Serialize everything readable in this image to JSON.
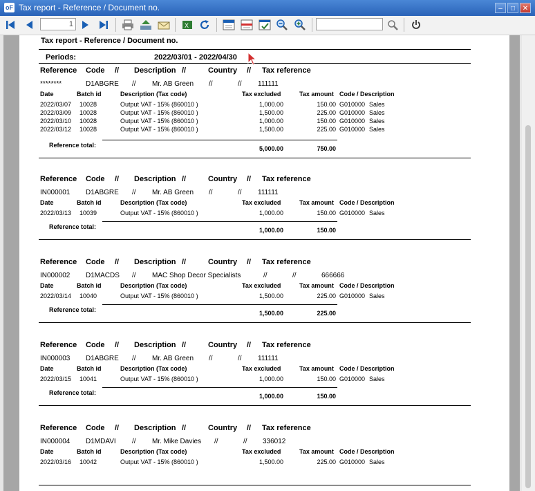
{
  "window": {
    "title": "Tax report - Reference / Document no.",
    "app_icon": "oF"
  },
  "toolbar": {
    "page_number": "1",
    "search_value": ""
  },
  "report": {
    "title": "Tax report - Reference / Document no.",
    "periods_label": "Periods:",
    "periods_value": "2022/03/01  -  2022/04/30",
    "group_header": {
      "reference": "Reference",
      "code": "Code",
      "sep1": "//",
      "description": "Description",
      "sep2": "//",
      "country": "Country",
      "sep3": "//",
      "tax_reference": "Tax reference"
    },
    "detail_header": {
      "date": "Date",
      "batch_id": "Batch id",
      "description": "Description (Tax code)",
      "tax_excluded": "Tax excluded",
      "tax_amount": "Tax amount",
      "code_desc": "Code / Description"
    },
    "reference_total_label": "Reference total:",
    "groups": [
      {
        "reference": "********",
        "code": "D1ABGRE",
        "sep1": "//",
        "description": "Mr. AB Green",
        "sep2": "//",
        "sep3": "//",
        "tax_reference": "111111",
        "rows": [
          {
            "date": "2022/03/07",
            "batch": "10028",
            "desc": "Output VAT - 15% (860010 )",
            "excl": "1,000.00",
            "tax": "150.00",
            "code": "G010000",
            "cdesc": "Sales"
          },
          {
            "date": "2022/03/09",
            "batch": "10028",
            "desc": "Output VAT - 15% (860010 )",
            "excl": "1,500.00",
            "tax": "225.00",
            "code": "G010000",
            "cdesc": "Sales"
          },
          {
            "date": "2022/03/10",
            "batch": "10028",
            "desc": "Output VAT - 15% (860010 )",
            "excl": "1,000.00",
            "tax": "150.00",
            "code": "G010000",
            "cdesc": "Sales"
          },
          {
            "date": "2022/03/12",
            "batch": "10028",
            "desc": "Output VAT - 15% (860010 )",
            "excl": "1,500.00",
            "tax": "225.00",
            "code": "G010000",
            "cdesc": "Sales"
          }
        ],
        "total_excl": "5,000.00",
        "total_tax": "750.00"
      },
      {
        "reference": "IN000001",
        "code": "D1ABGRE",
        "sep1": "//",
        "description": "Mr. AB Green",
        "sep2": "//",
        "sep3": "//",
        "tax_reference": "111111",
        "rows": [
          {
            "date": "2022/03/13",
            "batch": "10039",
            "desc": "Output VAT - 15% (860010 )",
            "excl": "1,000.00",
            "tax": "150.00",
            "code": "G010000",
            "cdesc": "Sales"
          }
        ],
        "total_excl": "1,000.00",
        "total_tax": "150.00"
      },
      {
        "reference": "IN000002",
        "code": "D1MACDS",
        "sep1": "//",
        "description": "MAC Shop Decor Specialists",
        "sep2": "//",
        "sep3": "//",
        "tax_reference": "666666",
        "rows": [
          {
            "date": "2022/03/14",
            "batch": "10040",
            "desc": "Output VAT - 15% (860010 )",
            "excl": "1,500.00",
            "tax": "225.00",
            "code": "G010000",
            "cdesc": "Sales"
          }
        ],
        "total_excl": "1,500.00",
        "total_tax": "225.00"
      },
      {
        "reference": "IN000003",
        "code": "D1ABGRE",
        "sep1": "//",
        "description": "Mr. AB Green",
        "sep2": "//",
        "sep3": "//",
        "tax_reference": "111111",
        "rows": [
          {
            "date": "2022/03/15",
            "batch": "10041",
            "desc": "Output VAT - 15% (860010 )",
            "excl": "1,000.00",
            "tax": "150.00",
            "code": "G010000",
            "cdesc": "Sales"
          }
        ],
        "total_excl": "1,000.00",
        "total_tax": "150.00"
      },
      {
        "reference": "IN000004",
        "code": "D1MDAVI",
        "sep1": "//",
        "description": "Mr. Mike Davies",
        "sep2": "//",
        "sep3": "//",
        "tax_reference": "336012",
        "rows": [
          {
            "date": "2022/03/16",
            "batch": "10042",
            "desc": "Output VAT - 15% (860010 )",
            "excl": "1,500.00",
            "tax": "225.00",
            "code": "G010000",
            "cdesc": "Sales"
          }
        ],
        "total_excl": "",
        "total_tax": ""
      }
    ]
  }
}
